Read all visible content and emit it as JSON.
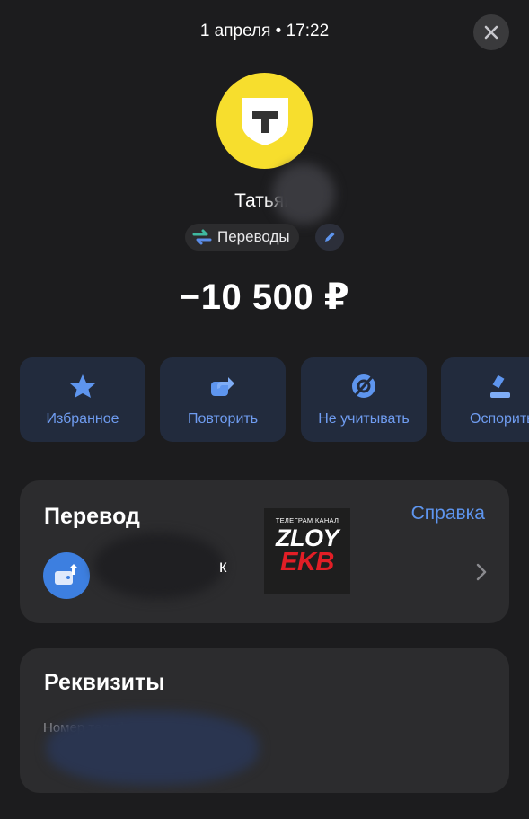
{
  "header": {
    "date": "1 апреля • 17:22"
  },
  "merchant": {
    "name": "Татьян",
    "logo_letter": "Т",
    "category": "Переводы"
  },
  "amount": "−10 500 ₽",
  "actions": [
    {
      "label": "Избранное",
      "icon": "star-icon"
    },
    {
      "label": "Повторить",
      "icon": "repeat-icon"
    },
    {
      "label": "Не учитывать",
      "icon": "exclude-icon"
    },
    {
      "label": "Оспорить",
      "icon": "dispute-icon"
    }
  ],
  "transfer_card": {
    "title": "Перевод",
    "help_link": "Справка",
    "banner_subtitle": "ТЕЛЕГРАМ КАНАЛ",
    "banner_word1": "ZLOY",
    "banner_word2": "EKB",
    "tail_char": "к"
  },
  "requisites_card": {
    "title": "Реквизиты",
    "field_label": "Номер телефона"
  },
  "colors": {
    "background": "#1c1c1e",
    "card": "#2c2c2e",
    "action_card": "#222b3d",
    "accent": "#5e95ee",
    "brand_yellow": "#f7de2d"
  }
}
